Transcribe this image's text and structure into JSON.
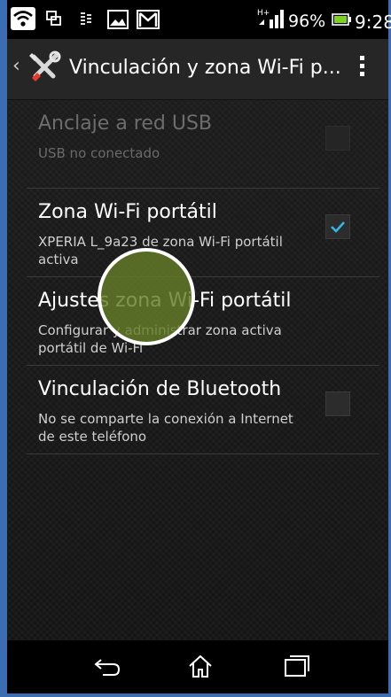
{
  "status_bar": {
    "battery_percent": "96%",
    "time": "9:28",
    "network_badge": "H+",
    "icons": [
      "wifi-icon",
      "screen-mirror-icon",
      "usb-tether-icon",
      "image-icon",
      "gmail-icon",
      "signal-icon",
      "battery-icon"
    ]
  },
  "action_bar": {
    "title": "Vinculación y zona Wi-Fi p...",
    "icons": [
      "back-chevron-icon",
      "settings-tools-icon",
      "overflow-menu-icon"
    ]
  },
  "settings": [
    {
      "title": "Anclaje a red USB",
      "summary": "USB no conectado",
      "checked": false,
      "enabled": false
    },
    {
      "title": "Zona Wi-Fi portátil",
      "summary": "XPERIA L_9a23 de zona Wi-Fi portátil activa",
      "checked": true,
      "enabled": true
    },
    {
      "title": "Ajustes zona Wi-Fi portátil",
      "summary": "Configurar y administrar zona activa portátil de Wi-Fi",
      "checked": null,
      "enabled": true
    },
    {
      "title": "Vinculación de Bluetooth",
      "summary": "No se comparte la conexión a Internet de este teléfono",
      "checked": false,
      "enabled": true
    }
  ],
  "nav_bar": {
    "icons": [
      "back-icon",
      "home-icon",
      "recent-apps-icon"
    ]
  },
  "colors": {
    "frame": "#3b6db3",
    "check": "#33b5e5",
    "touch_indicator": "#647d28"
  }
}
